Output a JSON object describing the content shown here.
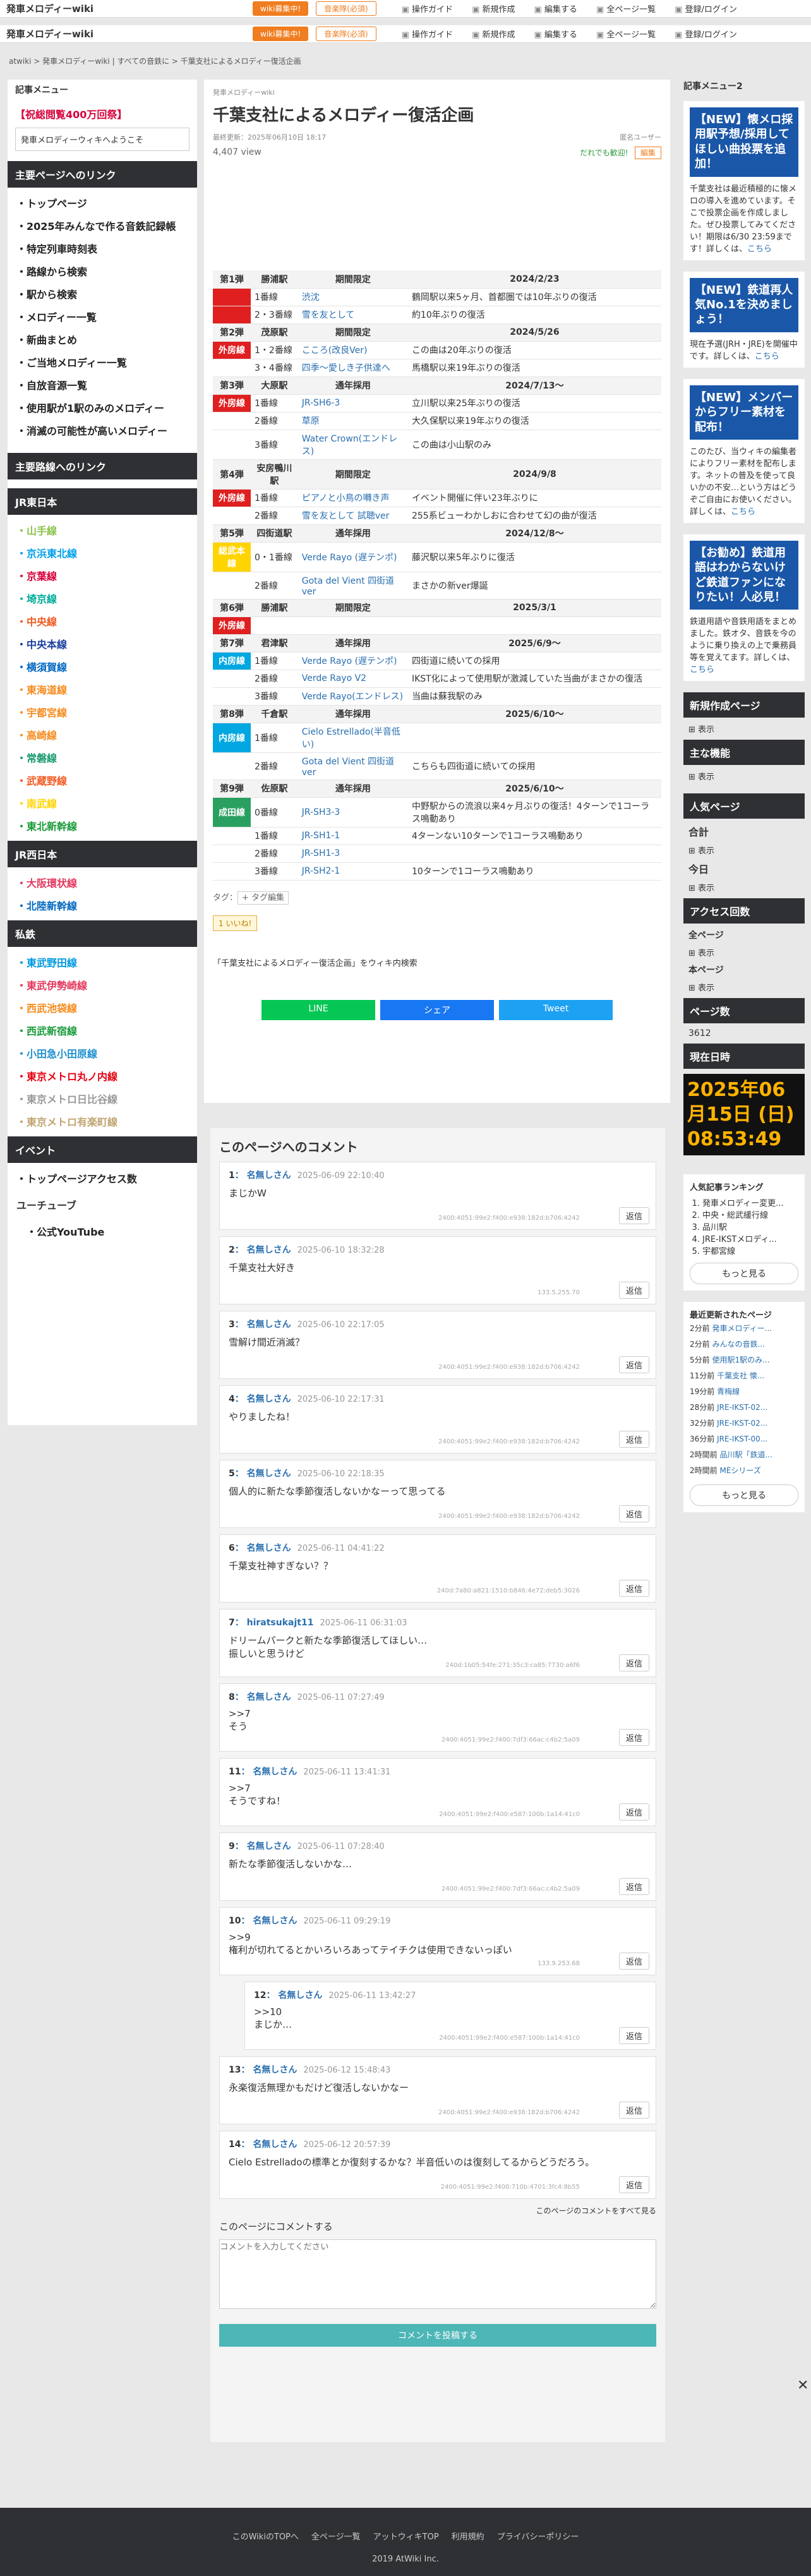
{
  "site": {
    "name": "発車メロディーwiki",
    "btn1": "wiki募集中!",
    "btn2": "音楽隊(必須)",
    "nav": [
      "操作ガイド",
      "新規作成",
      "編集する",
      "全ページ一覧",
      "登録/ログイン"
    ]
  },
  "breadcrumb": "atwiki > 発車メロディーwiki | すべての音鉄に > 千葉支社によるメロディー復活企画",
  "left": {
    "menu": "記事メニュー",
    "ban": "【祝総閲覧400万回祭】",
    "welcome": "発車メロディーウィキへようこそ",
    "h1": "主要ページへのリンク",
    "items": [
      "トップページ",
      "2025年みんなで作る音鉄記録帳",
      "特定列車時刻表",
      "路線から検索",
      "駅から検索",
      "メロディー一覧",
      "新曲まとめ",
      "ご当地メロディー一覧",
      "自放音源一覧",
      "使用駅が1駅のみのメロディー",
      "消滅の可能性が高いメロディー"
    ],
    "h2": "主要路線へのリンク",
    "h3": "JR東日本",
    "jre": [
      {
        "t": "山手線",
        "c": "#8bc34a"
      },
      {
        "t": "京浜東北線",
        "c": "#00a0e9"
      },
      {
        "t": "京葉線",
        "c": "#d7003a"
      },
      {
        "t": "埼京線",
        "c": "#00ac9a"
      },
      {
        "t": "中央線",
        "c": "#f15a22"
      },
      {
        "t": "中央本線",
        "c": "#1a3fa0"
      },
      {
        "t": "横須賀線",
        "c": "#0067c0"
      },
      {
        "t": "東海道線",
        "c": "#f68b1e"
      },
      {
        "t": "宇都宮線",
        "c": "#f68b1e"
      },
      {
        "t": "高崎線",
        "c": "#f68b1e"
      },
      {
        "t": "常磐線",
        "c": "#1a9b6e"
      },
      {
        "t": "武蔵野線",
        "c": "#f15a22"
      },
      {
        "t": "南武線",
        "c": "#ffd400"
      },
      {
        "t": "東北新幹線",
        "c": "#1a9b3a"
      }
    ],
    "h4": "JR西日本",
    "jrw": [
      {
        "t": "大阪環状線",
        "c": "#e4385f"
      },
      {
        "t": "北陸新幹線",
        "c": "#0067c0"
      }
    ],
    "h5": "私鉄",
    "pv": [
      {
        "t": "東武野田線",
        "c": "#0099e0"
      },
      {
        "t": "東武伊勢崎線",
        "c": "#e4385f"
      },
      {
        "t": "西武池袋線",
        "c": "#f68b1e"
      },
      {
        "t": "西武新宿線",
        "c": "#1a9b3a"
      },
      {
        "t": "小田急小田原線",
        "c": "#1e90d0"
      },
      {
        "t": "東京メトロ丸ノ内線",
        "c": "#e60012"
      },
      {
        "t": "東京メトロ日比谷線",
        "c": "#9a9a9a"
      },
      {
        "t": "東京メトロ有楽町線",
        "c": "#c1a470"
      }
    ],
    "h6": "イベント",
    "ev": "トップページアクセス数",
    "h7": "ユーチューブ",
    "yt": "公式YouTube"
  },
  "main": {
    "sub": "発車メロディーwiki",
    "title": "千葉支社によるメロディー復活企画",
    "updated": "最終更新：2025年06月10日 18:17",
    "author": "匿名ユーザー",
    "views": "4,407 view",
    "lock": "だれでも歓迎!",
    "edit": "編集",
    "tags": "タグ：",
    "tagbtn": "+ タグ編集",
    "likes": "1 いいね!",
    "search": "「千葉支社によるメロディー復活企画」をウィキ内検索",
    "share": [
      "LINE",
      "シェア",
      "Tweet"
    ]
  },
  "table": [
    {
      "h": [
        "第1弾",
        "勝浦駅",
        "期間限定",
        "2024/2/23"
      ]
    },
    {
      "c": "",
      "r": [
        "1番線",
        "渋沈",
        "鶴岡駅以来5ヶ月、首都圏では10年ぶりの復活"
      ]
    },
    {
      "c": "",
      "r": [
        "2・3番線",
        "雪を友として",
        "約10年ぶりの復活"
      ]
    },
    {
      "h": [
        "第2弾",
        "茂原駅",
        "期間限定",
        "2024/5/26"
      ]
    },
    {
      "c": "外房線",
      "r": [
        "1・2番線",
        "こころ(改良Ver)",
        "この曲は20年ぶりの復活"
      ]
    },
    {
      "c": "",
      "r": [
        "3・4番線",
        "四季～愛しき子供達へ",
        "馬橋駅以来19年ぶりの復活"
      ]
    },
    {
      "h": [
        "第3弾",
        "大原駅",
        "通年採用",
        "2024/7/13～"
      ]
    },
    {
      "c": "外房線",
      "r": [
        "1番線",
        "JR-SH6-3",
        "立川駅以来25年ぶりの復活"
      ]
    },
    {
      "c": "",
      "r": [
        "2番線",
        "草原",
        "大久保駅以来19年ぶりの復活"
      ]
    },
    {
      "c": "",
      "r": [
        "3番線",
        "Water Crown(エンドレス)",
        "この曲は小山駅のみ"
      ]
    },
    {
      "h": [
        "第4弾",
        "安房鴨川駅",
        "期間限定",
        "2024/9/8"
      ]
    },
    {
      "c": "外房線",
      "r": [
        "1番線",
        "ピアノと小鳥の囀き声",
        "イベント開催に伴い23年ぶりに"
      ]
    },
    {
      "c": "",
      "r": [
        "2番線",
        "雪を友として 試聴ver",
        "255系ビューわかしおに合わせて幻の曲が復活"
      ]
    },
    {
      "h": [
        "第5弾",
        "四街道駅",
        "通年採用",
        "2024/12/8～"
      ]
    },
    {
      "c": "総武本線",
      "r": [
        "0・1番線",
        "Verde Rayo (遅テンポ)",
        "藤沢駅以来5年ぶりに復活"
      ]
    },
    {
      "c": "",
      "r": [
        "2番線",
        "Gota del Vient 四街道ver",
        "まさかの新ver爆誕"
      ]
    },
    {
      "h": [
        "第6弾",
        "勝浦駅",
        "期間限定",
        "2025/3/1"
      ]
    },
    {
      "c": "外房線",
      "r": [
        "",
        "",
        ""
      ]
    },
    {
      "h": [
        "第7弾",
        "君津駅",
        "通年採用",
        "2025/6/9～"
      ]
    },
    {
      "c": "内房線",
      "r": [
        "1番線",
        "Verde Rayo (遅テンポ)",
        "四街道に続いての採用"
      ]
    },
    {
      "c": "",
      "r": [
        "2番線",
        "Verde Rayo V2",
        "IKST化によって使用駅が激減していた当曲がまさかの復活"
      ]
    },
    {
      "c": "",
      "r": [
        "3番線",
        "Verde Rayo(エンドレス)",
        "当曲は蘇我駅のみ"
      ]
    },
    {
      "h": [
        "第8弾",
        "千倉駅",
        "通年採用",
        "2025/6/10～"
      ]
    },
    {
      "c": "内房線",
      "r": [
        "1番線",
        "Cielo Estrellado(半音低い)",
        ""
      ]
    },
    {
      "c": "",
      "r": [
        "2番線",
        "Gota del Vient 四街道ver",
        "こちらも四街道に続いての採用"
      ]
    },
    {
      "h": [
        "第9弾",
        "佐原駅",
        "通年採用",
        "2025/6/10～"
      ]
    },
    {
      "c": "成田線",
      "r": [
        "0番線",
        "JR-SH3-3",
        "中野駅からの流浪以来4ヶ月ぶりの復活！4ターンで1コーラス鳴動あり"
      ]
    },
    {
      "c": "",
      "r": [
        "1番線",
        "JR-SH1-1",
        "4ターンない10ターンで1コーラス鳴動あり"
      ]
    },
    {
      "c": "",
      "r": [
        "2番線",
        "JR-SH1-3",
        ""
      ]
    },
    {
      "c": "",
      "r": [
        "3番線",
        "JR-SH2-1",
        "10ターンで1コーラス鳴動あり"
      ]
    }
  ],
  "comments": {
    "title": "このページへのコメント",
    "list": [
      {
        "n": "1",
        "name": "名無しさん",
        "date": "2025-06-09 22:10:40",
        "body": "まじかW",
        "ip": "2400:4051:99e2:f400:e938:182d:b706:4242"
      },
      {
        "n": "2",
        "name": "名無しさん",
        "date": "2025-06-10 18:32:28",
        "body": "千葉支社大好き",
        "ip": "133.5.255.70"
      },
      {
        "n": "3",
        "name": "名無しさん",
        "date": "2025-06-10 22:17:05",
        "body": "雪解け間近消滅？",
        "ip": "2400:4051:99e2:f400:e938:182d:b706:4242"
      },
      {
        "n": "4",
        "name": "名無しさん",
        "date": "2025-06-10 22:17:31",
        "body": "やりましたね！",
        "ip": "2400:4051:99e2:f400:e938:182d:b706:4242"
      },
      {
        "n": "5",
        "name": "名無しさん",
        "date": "2025-06-10 22:18:35",
        "body": "個人的に新たな季節復活しないかなーって思ってる",
        "ip": "2400:4051:99e2:f400:e938:182d:b706:4242"
      },
      {
        "n": "6",
        "name": "名無しさん",
        "date": "2025-06-11 04:41:22",
        "body": "千葉支社神すぎない？？",
        "ip": "240d:7a80:a821:1510:b846:4e72:deb5:3026"
      },
      {
        "n": "7",
        "name": "hiratsukajt11",
        "date": "2025-06-11 06:31:03",
        "body": "ドリームパークと新たな季節復活してほしい…\n振しいと思うけど",
        "ip": "240d:1b05:54fe:271:35c3:ca85:7730:a6f6"
      },
      {
        "n": "8",
        "name": "名無しさん",
        "date": "2025-06-11 07:27:49",
        "body": ">>7\nそう",
        "ip": "2400:4051:99e2:f400:7df3:66ac:c4b2:5a09"
      },
      {
        "n": "11",
        "name": "名無しさん",
        "date": "2025-06-11 13:41:31",
        "body": ">>7\nそうですね！",
        "ip": "2400:4051:99e2:f400:e587:100b:1a14:41c0"
      },
      {
        "n": "9",
        "name": "名無しさん",
        "date": "2025-06-11 07:28:40",
        "body": "新たな季節復活しないかな…",
        "ip": "2400:4051:99e2:f400:7df3:66ac:c4b2:5a09"
      },
      {
        "n": "10",
        "name": "名無しさん",
        "date": "2025-06-11 09:29:19",
        "body": ">>9\n権利が切れてるとかいろいろあってテイチクは使用できないっぽい",
        "ip": "133.9.253.68"
      },
      {
        "n": "12",
        "name": "名無しさん",
        "date": "2025-06-11 13:42:27",
        "body": ">>10\nまじか…",
        "ip": "2400:4051:99e2:f400:e587:100b:1a14:41c0"
      },
      {
        "n": "13",
        "name": "名無しさん",
        "date": "2025-06-12 15:48:43",
        "body": "永楽復活無理かもだけど復活しないかなー",
        "ip": "2400:4051:99e2:f400:e938:182d:b706:4242"
      },
      {
        "n": "14",
        "name": "名無しさん",
        "date": "2025-06-12 20:57:39",
        "body": "Cielo Estrelladoの標準とか復刻するかな？半音低いのは復刻してるからどうだろう。",
        "ip": "2400:4051:99e2:f400:710b:4701:3fc4:8b55"
      }
    ],
    "all": "このページのコメントをすべて見る",
    "label": "このページにコメントする",
    "ph": "コメントを入力してください",
    "submit": "コメントを投稿する"
  },
  "right": {
    "menu": "記事メニュー2",
    "n1": "【NEW】懐メロ採用駅予想/採用してほしい曲投票を追加！",
    "t1": "千葉支社は最近積極的に懐メロの導入を進めています。そこで投票企画を作成しました。ぜひ投票してみてください！期限は6/30 23:59まです！詳しくは、",
    "n2": "【NEW】鉄道再人気No.1を決めましょう！",
    "t2": "現在予選(JRH・JRE)を開催中です。詳しくは、",
    "n3": "【NEW】メンバーからフリー素材を配布！",
    "t3": "このたび、当ウィキの編集者によりフリー素材を配布します。ネットの普及を使って良いかの不安…という方はどうぞご自由にお使いください。詳しくは、",
    "n4": "【お勧め】鉄道用語はわからないけど鉄道ファンになりたい！人必見！",
    "t4": "鉄道用語や音鉄用語をまとめました。鉄オタ、音鉄を今のように乗り換えの上で乗務員等を覚えてます。詳しくは、",
    "more": "こちら",
    "h1": "新規作成ページ",
    "show": "表示",
    "h2": "主な機能",
    "h3": "人気ページ",
    "tot": "合計",
    "today": "今日",
    "h4": "アクセス回数",
    "all": "全ページ",
    "this": "本ページ",
    "h5": "ページ数",
    "pages": "3612",
    "h6": "現在日時",
    "date": "2025年06月15日 (日)",
    "time": "08:53:49",
    "rank": "人気記事ランキング",
    "ranks": [
      "発車メロディー変更...",
      "中央・総武緩行線",
      "品川駅",
      "JRE-IKSTメロディ...",
      "宇都宮線"
    ],
    "seemore": "もっと見る",
    "recent": "最近更新されたページ",
    "rec": [
      {
        "a": "2分前",
        "t": "発車メロディー..."
      },
      {
        "a": "2分前",
        "t": "みんなの音鉄..."
      },
      {
        "a": "5分前",
        "t": "使用駅1駅のみ..."
      },
      {
        "a": "11分前",
        "t": "千葉支社 懐..."
      },
      {
        "a": "19分前",
        "t": "青梅線"
      },
      {
        "a": "28分前",
        "t": "JRE-IKST-02..."
      },
      {
        "a": "32分前",
        "t": "JRE-IKST-02..."
      },
      {
        "a": "36分前",
        "t": "JRE-IKST-00..."
      },
      {
        "a": "2時間前",
        "t": "品川駅「鉄道..."
      },
      {
        "a": "2時間前",
        "t": "MEシリーズ"
      }
    ]
  },
  "footer": {
    "links": [
      "このWikiのTOPへ",
      "全ページ一覧",
      "アットウィキTOP",
      "利用規約",
      "プライバシーポリシー"
    ],
    "copy": "2019 AtWiki Inc."
  }
}
